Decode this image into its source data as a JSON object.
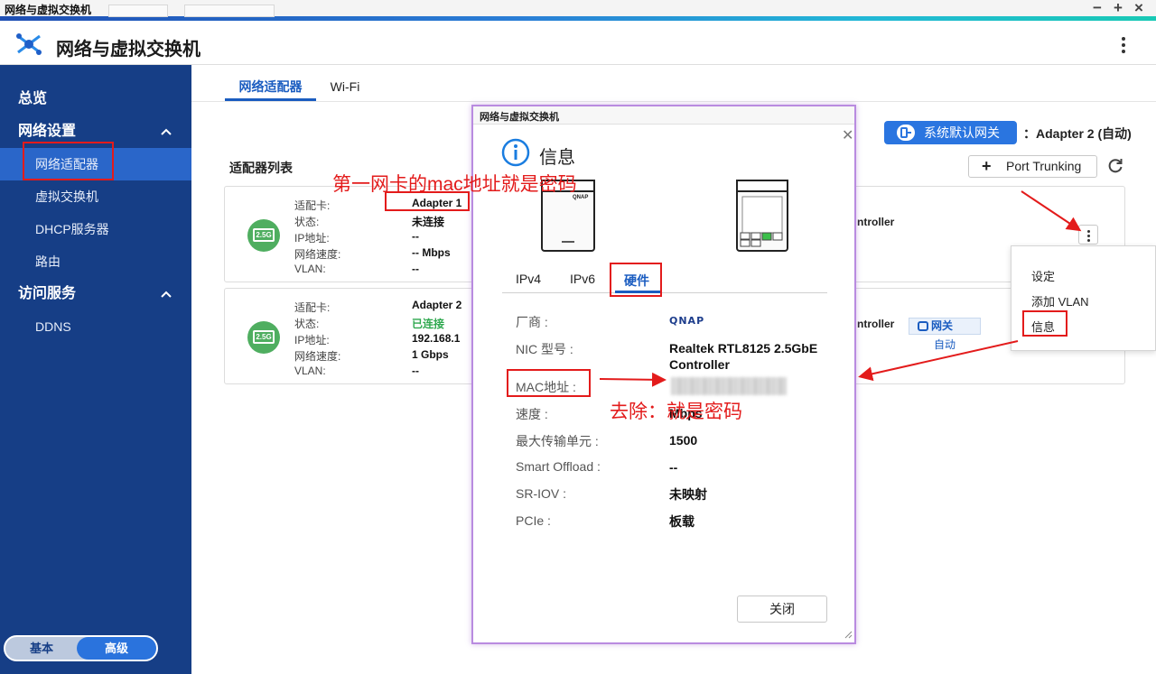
{
  "window": {
    "title": "网络与虚拟交换机",
    "minimize": "−",
    "maximize": "+",
    "close": "×"
  },
  "app": {
    "name": "网络与虚拟交换机"
  },
  "sidebar": {
    "overview": "总览",
    "network_settings": "网络设置",
    "items": [
      {
        "label": "网络适配器"
      },
      {
        "label": "虚拟交换机"
      },
      {
        "label": "DHCP服务器"
      },
      {
        "label": "路由"
      }
    ],
    "access_services": "访问服务",
    "access_items": [
      {
        "label": "DDNS"
      }
    ],
    "mode": {
      "basic": "基本",
      "advanced": "高级"
    }
  },
  "tabs": [
    {
      "label": "网络适配器"
    },
    {
      "label": "Wi-Fi"
    }
  ],
  "gateway": {
    "button": "系统默认网关",
    "value": "：Adapter 2 (自动)"
  },
  "adapter_list": {
    "title": "适配器列表",
    "port_trunking": "Port Trunking",
    "adapters": [
      {
        "labels": [
          "适配卡:",
          "状态:",
          "IP地址:",
          "网络速度:",
          "VLAN:"
        ],
        "name": "Adapter 1",
        "status": "未连接",
        "ip": "--",
        "speed": "-- Mbps",
        "vlan": "--",
        "controller": "ntroller",
        "badge": "2.5G"
      },
      {
        "labels": [
          "适配卡:",
          "状态:",
          "IP地址:",
          "网络速度:",
          "VLAN:"
        ],
        "name": "Adapter 2",
        "status": "已连接",
        "ip": "192.168.1",
        "speed": "1 Gbps",
        "vlan": "--",
        "controller": "ntroller",
        "badge": "2.5G",
        "gateway_chip": "网关",
        "gateway_mode": "自动"
      }
    ]
  },
  "context_menu": {
    "items": [
      "设定",
      "添加 VLAN",
      "信息"
    ]
  },
  "dialog": {
    "window_title": "网络与虚拟交换机",
    "title": "信息",
    "tabs": [
      "IPv4",
      "IPv6",
      "硬件"
    ],
    "fields": [
      {
        "label": "厂商 :",
        "value": "QNAP"
      },
      {
        "label": "NIC 型号 :",
        "value": "Realtek RTL8125 2.5GbE Controller"
      },
      {
        "label": "MAC地址 :",
        "value": ""
      },
      {
        "label": "速度 :",
        "value": "Mbps"
      },
      {
        "label": "最大传输单元 :",
        "value": "1500"
      },
      {
        "label": "Smart Offload :",
        "value": "--"
      },
      {
        "label": "SR-IOV :",
        "value": "未映射"
      },
      {
        "label": "PCIe :",
        "value": "板载"
      }
    ],
    "close_button": "关闭"
  },
  "annotations": {
    "top": "第一网卡的mac地址就是密码",
    "middle": "去除：就是密码",
    "color": "#e31b1b"
  },
  "colors": {
    "sidebar": "#163e86",
    "sidebar_active": "#2a66c9",
    "accent": "#1a5cc0",
    "connected": "#2fa84f",
    "nic_badge": "#4fae60"
  }
}
